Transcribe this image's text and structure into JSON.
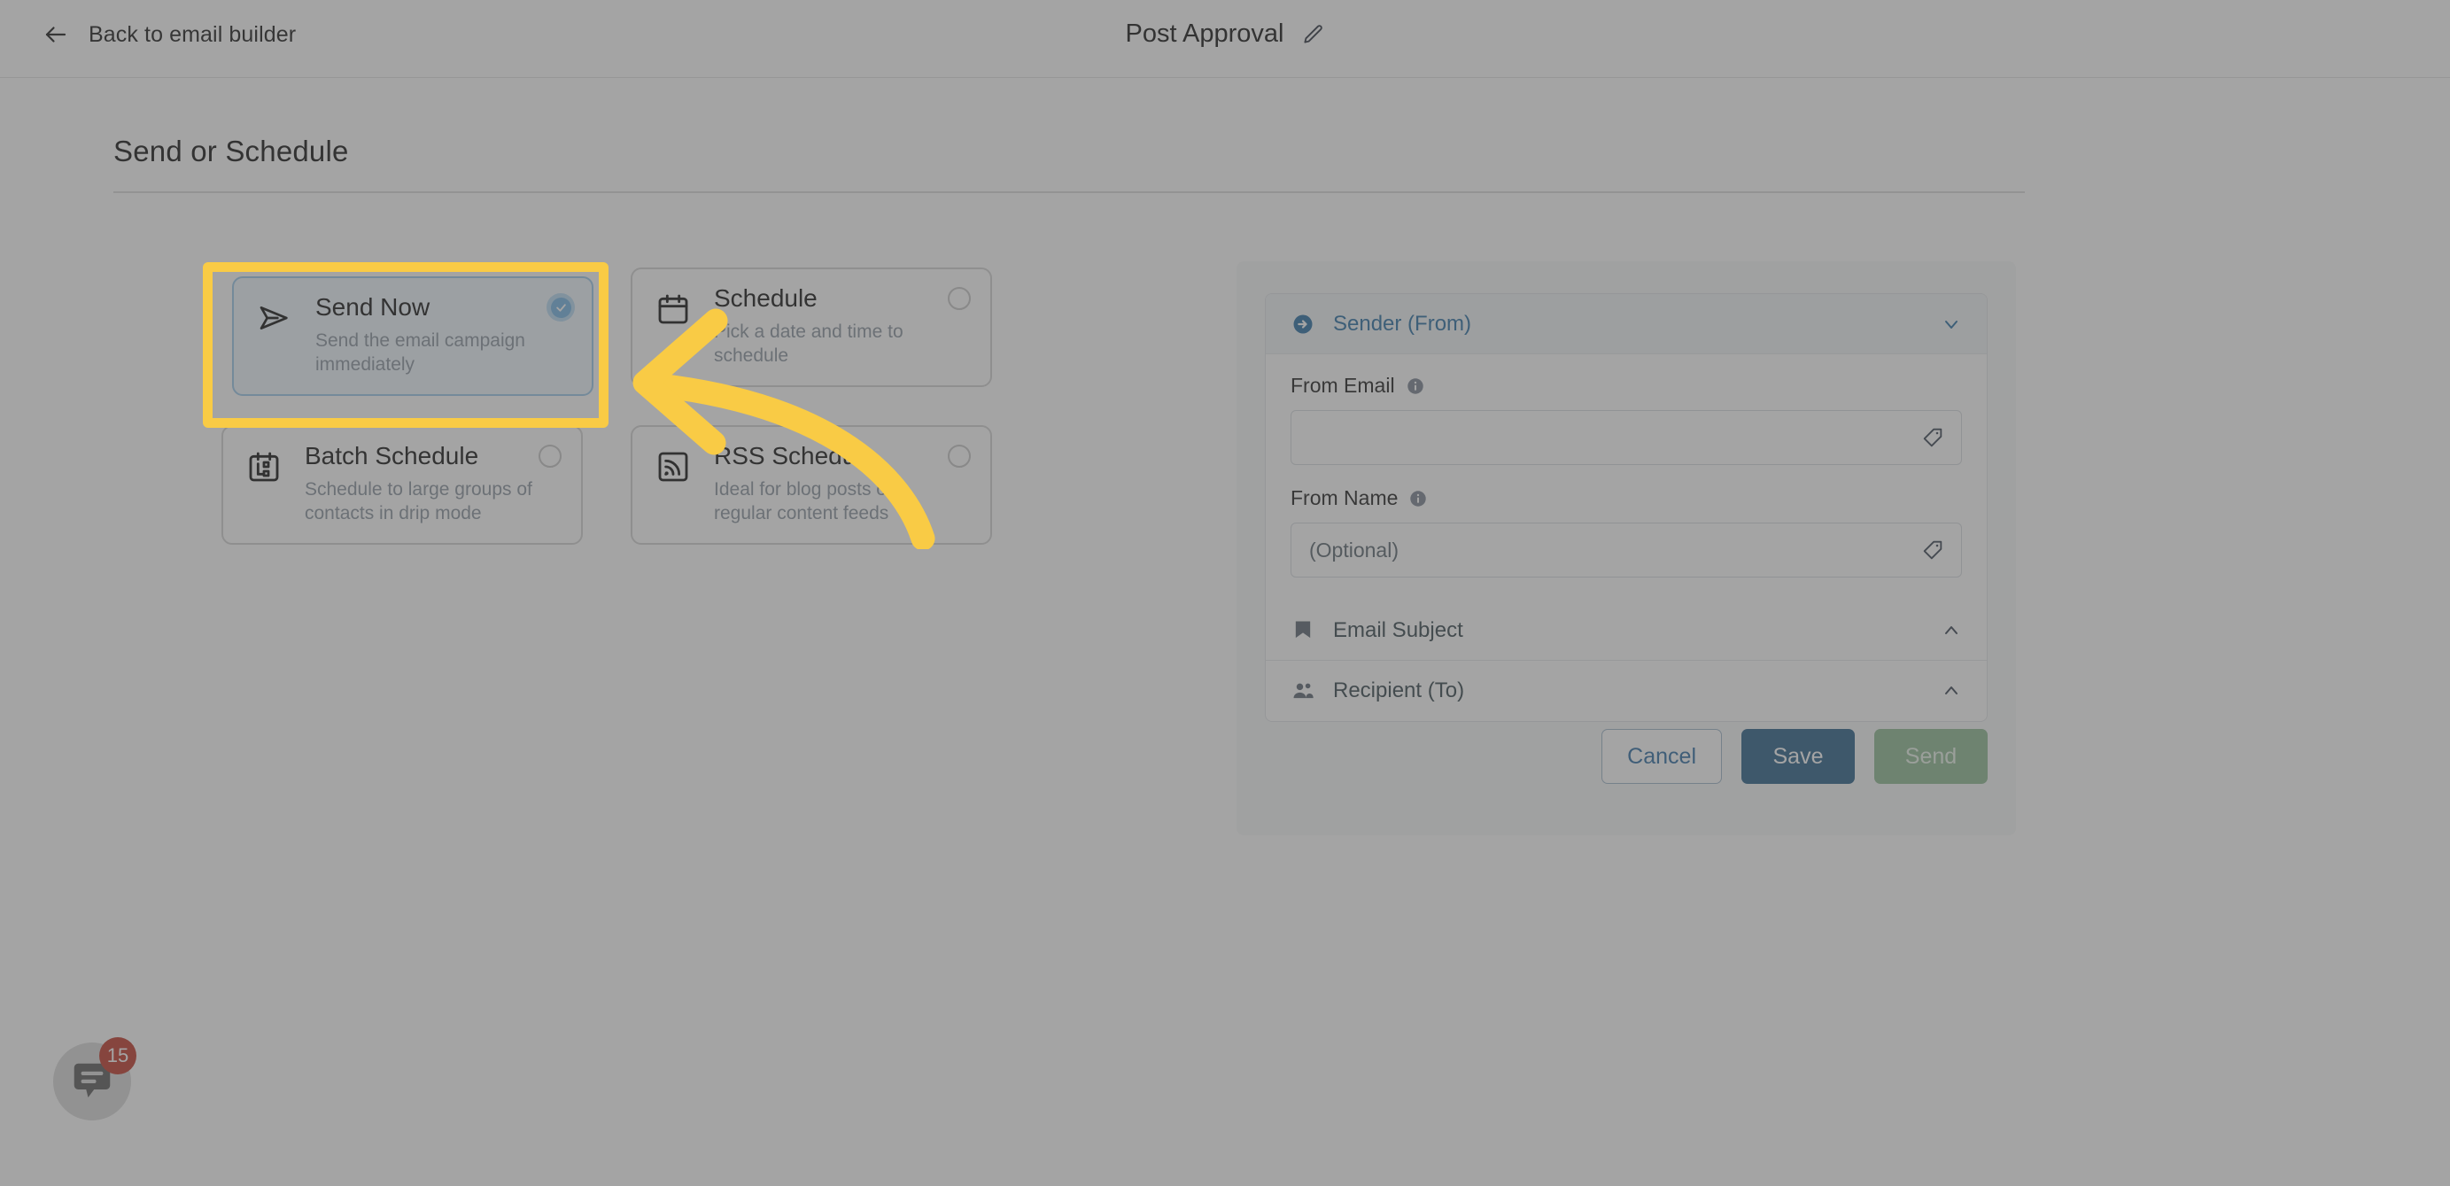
{
  "topbar": {
    "back_label": "Back to email builder",
    "back_icon": "arrow-left-icon",
    "title": "Post Approval",
    "edit_icon": "pencil-icon"
  },
  "page": {
    "section_title": "Send or Schedule"
  },
  "options": [
    {
      "id": "send-now",
      "title": "Send Now",
      "description": "Send the email campaign immediately",
      "icon": "paper-plane-icon",
      "selected": true,
      "highlighted": true
    },
    {
      "id": "schedule",
      "title": "Schedule",
      "description": "Pick a date and time to schedule",
      "icon": "calendar-icon",
      "selected": false,
      "highlighted": false
    },
    {
      "id": "batch-schedule",
      "title": "Batch Schedule",
      "description": "Schedule to large groups of contacts in drip mode",
      "icon": "calendar-batch-icon",
      "selected": false,
      "highlighted": false
    },
    {
      "id": "rss-schedule",
      "title": "RSS Schedule",
      "description": "Ideal for blog posts or regular content feeds",
      "icon": "rss-icon",
      "selected": false,
      "highlighted": false
    }
  ],
  "side_panel": {
    "sections": [
      {
        "id": "sender-from",
        "label": "Sender (From)",
        "icon": "arrow-circle-right-icon",
        "expanded": true,
        "chevron": "chevron-down-icon"
      },
      {
        "id": "email-subject",
        "label": "Email Subject",
        "icon": "bookmark-icon",
        "expanded": false,
        "chevron": "chevron-up-icon"
      },
      {
        "id": "recipient-to",
        "label": "Recipient (To)",
        "icon": "users-icon",
        "expanded": false,
        "chevron": "chevron-up-icon"
      }
    ],
    "fields": [
      {
        "id": "from-email",
        "label": "From Email",
        "info_icon": "info-icon",
        "value": "",
        "placeholder": "",
        "trailing_icon": "tag-icon"
      },
      {
        "id": "from-name",
        "label": "From Name",
        "info_icon": "info-icon",
        "value": "",
        "placeholder": "(Optional)",
        "trailing_icon": "tag-icon"
      }
    ],
    "actions": {
      "cancel_label": "Cancel",
      "save_label": "Save",
      "send_label": "Send"
    }
  },
  "chat_widget": {
    "icon": "chat-bubble-icon",
    "badge_count": "15"
  },
  "annotation": {
    "highlight_color": "#f9cb45",
    "arrow_color": "#f9cb45",
    "target": "send-now"
  },
  "colors": {
    "accent_blue": "#2a6fa3",
    "save_blue": "#2b6189",
    "send_green": "#8fbb93",
    "selected_card_bg": "#eef6fd",
    "selected_card_border": "#9cc8ea",
    "badge_red": "#c0392b"
  }
}
